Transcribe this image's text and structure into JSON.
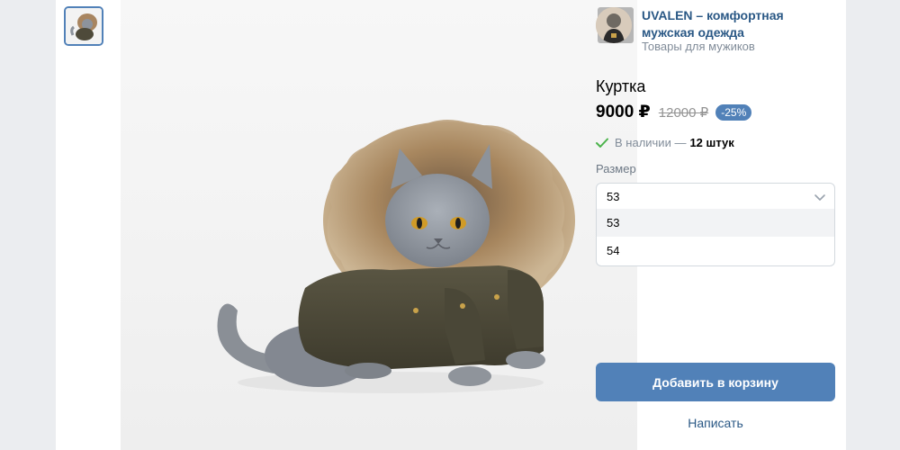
{
  "shop": {
    "name": "UVALEN – комфортная мужская одежда",
    "subtitle": "Товары для мужиков"
  },
  "product": {
    "title": "Куртка",
    "price": "9000 ₽",
    "old_price": "12000 ₽",
    "discount": "-25%",
    "stock_text": "В наличии —",
    "stock_count": "12 штук"
  },
  "size": {
    "label": "Размер",
    "selected": "53",
    "options": [
      "53",
      "54"
    ]
  },
  "actions": {
    "add_to_cart": "Добавить в корзину",
    "write": "Написать"
  },
  "icons": {
    "zoom": "zoom-in-icon",
    "stock": "checkmark-icon",
    "select": "chevron-down-icon"
  },
  "colors": {
    "accent": "#5181b8",
    "link": "#2a5885",
    "stock_check": "#4bb34b"
  }
}
